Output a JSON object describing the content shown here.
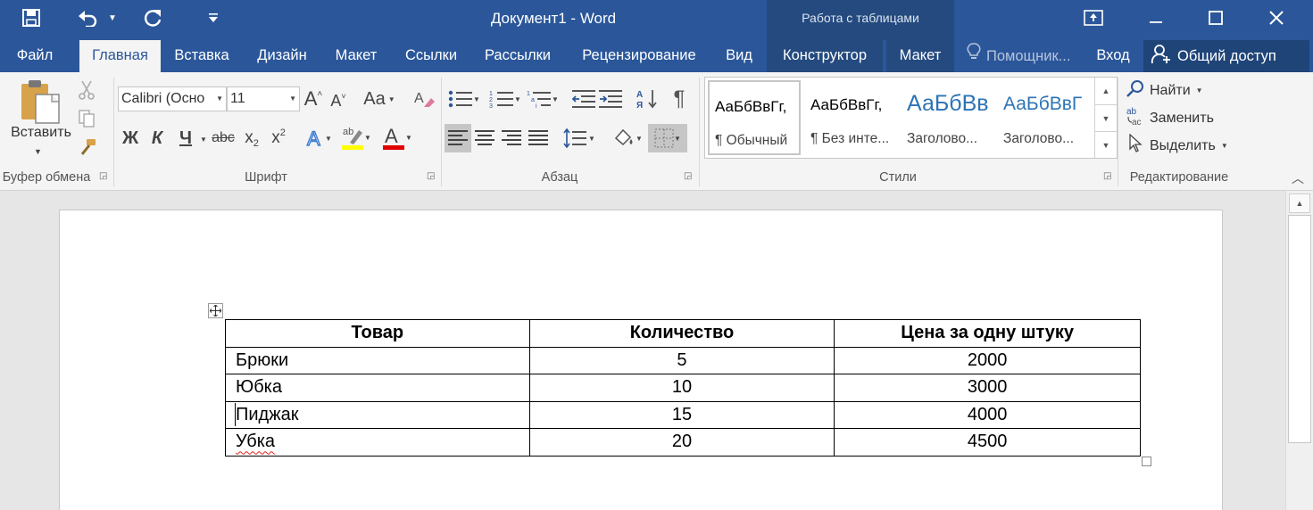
{
  "title_bar": {
    "document_title": "Документ1 - Word",
    "context_title": "Работа с таблицами",
    "qat": {
      "save_icon": "save-icon",
      "undo_icon": "undo-icon",
      "redo_icon": "repeat-icon",
      "customize_icon": "customize-qat-icon"
    },
    "window_buttons": [
      "ribbon-display-icon",
      "minimize-icon",
      "maximize-icon",
      "close-icon"
    ]
  },
  "tabs": [
    {
      "label": "Файл"
    },
    {
      "label": "Главная"
    },
    {
      "label": "Вставка"
    },
    {
      "label": "Дизайн"
    },
    {
      "label": "Макет"
    },
    {
      "label": "Ссылки"
    },
    {
      "label": "Рассылки"
    },
    {
      "label": "Рецензирование"
    },
    {
      "label": "Вид"
    },
    {
      "label": "Конструктор"
    },
    {
      "label": "Макет"
    }
  ],
  "active_tab": "Главная",
  "tell_me": "Помощник...",
  "sign_in": "Вход",
  "share": "Общий доступ",
  "ribbon": {
    "clipboard": {
      "paste_label": "Вставить",
      "group_label": "Буфер обмена"
    },
    "font": {
      "font_name": "Calibri (Осно",
      "font_size": "11",
      "case_label": "Aa",
      "bold": "Ж",
      "italic": "К",
      "underline": "Ч",
      "strike": "abc",
      "subscript_base": "x",
      "subscript": "2",
      "superscript_base": "x",
      "superscript": "2",
      "group_label": "Шрифт",
      "highlight_color": "#ffff00",
      "font_color": "#e00000"
    },
    "paragraph": {
      "group_label": "Абзац"
    },
    "styles": {
      "group_label": "Стили",
      "items": [
        {
          "sample": "АаБбВвГг,",
          "name": "¶ Обычный"
        },
        {
          "sample": "АаБбВвГг,",
          "name": "¶ Без инте..."
        },
        {
          "sample": "АаБбВв",
          "name": "Заголово..."
        },
        {
          "sample": "АаБбВвГ",
          "name": "Заголово..."
        }
      ]
    },
    "editing": {
      "group_label": "Редактирование",
      "find": "Найти",
      "replace": "Заменить",
      "select": "Выделить"
    }
  },
  "table": {
    "headers": [
      "Товар",
      "Количество",
      "Цена за одну штуку"
    ],
    "rows": [
      [
        "Брюки",
        "5",
        "2000"
      ],
      [
        "Юбка",
        "10",
        "3000"
      ],
      [
        "Пиджак",
        "15",
        "4000"
      ],
      [
        "Убка",
        "20",
        "4500"
      ]
    ]
  },
  "colors": {
    "brand": "#2b579a",
    "context": "#244a7f"
  }
}
